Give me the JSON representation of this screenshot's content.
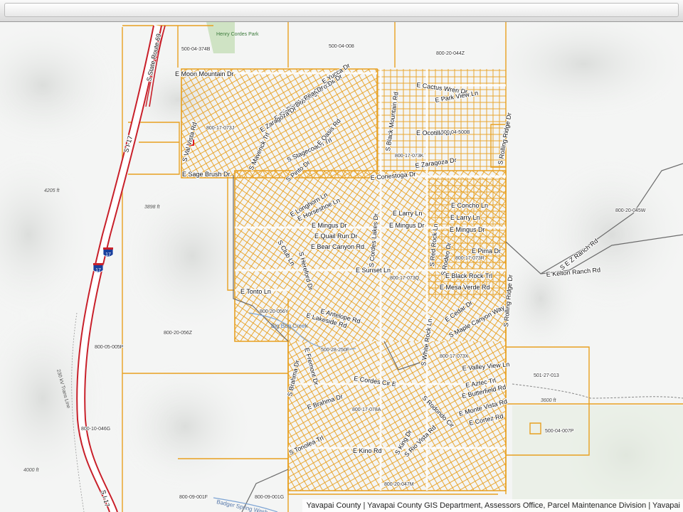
{
  "map": {
    "attribution": "Yavapai County | Yavapai County GIS Department, Assessors Office, Parcel Maintenance Division | Yavapai",
    "colors": {
      "parcel": "#e8a020",
      "road": "#6b6b6b",
      "highway": "#c8202a",
      "water": "#7da4d4",
      "park": "#cfe3c4",
      "terrain": "#f4f5f4"
    },
    "highway_shields": [
      "17",
      "17"
    ],
    "streets": [
      "E Moon Mountain Dr",
      "E Yucca Dr",
      "E Cholla Dr",
      "E Saguaro Dr",
      "E Ocotillo Dr",
      "E Prickly Pear Dr",
      "E Sierra Dr",
      "E Zaragoza Dr",
      "S Val Vista Rd",
      "S Maverick Trl",
      "S Stagecoach Trl",
      "E Oasis Rd",
      "S Pinto Dr",
      "E Sage Brush Dr",
      "E Conestoga Dr",
      "E Cactus Wren Dr",
      "E Park View Ln",
      "S Black Mountain Rd",
      "E Ocotillo Dr",
      "S Rolling Ridge Dr",
      "E Zaragoza Dr",
      "E Longhorn Ln",
      "E Horseshoe Ln",
      "E Concho Ln",
      "E Larry Ln",
      "E Larry Ln",
      "E Mingus Dr",
      "E Mingus Dr",
      "E Mingus Dr",
      "S Cordes Lakes Dr",
      "E Quail Run Dr",
      "S Club Ln",
      "S Hereford Dr",
      "E Bear Canyon Rd",
      "S Red Rock Ln",
      "S Rodeo Dr",
      "E Pima Dr",
      "E Sunset Ln",
      "E Black Rock Trl",
      "E Mesa Verde Rd",
      "E Tonto Ln",
      "E Antelope Rd",
      "E Lakeside Rd",
      "E Cedar Dr",
      "S Maple Canyon Way",
      "S Rolling Ridge Dr",
      "S Brahma Dr",
      "E Fremont Dr",
      "S White Rock Ln",
      "E Valley View Ln",
      "E Cordes Cir E",
      "E Aztec Trl",
      "E Butterfield Rd",
      "E Brahma Dr",
      "S Rodondo Cir",
      "E Monte Vista Rd",
      "E Cortez Rd",
      "S Tonolea Trl",
      "S King Dr",
      "S Rio Vista Rd",
      "E Kino Rd",
      "S E Z Ranch Rd",
      "E Kelton Ranch Rd",
      "S State Route 69",
      "S I-17",
      "S I-17"
    ],
    "parcels": [
      "500-04-374B",
      "500-04-008",
      "800-20-044Z",
      "500-04-500B",
      "800-17-073J",
      "800-17-073K",
      "800-17-073R",
      "800-17-073Q",
      "800-20-056Y",
      "800-20-056Z",
      "800-05-005P",
      "500-28-250F",
      "800-17-073X",
      "501-27-013",
      "800-17-078A",
      "800-20-045W",
      "800-10-046G",
      "500-04-007P",
      "800-20-047M",
      "800-09-001F",
      "800-09-001G"
    ],
    "places": [
      "Henry Cordes Park",
      "Big Bug Creek",
      "Badger Spring Wash",
      "230 kV Trans Line"
    ],
    "elevations": [
      "4205 ft",
      "3898 ft",
      "4000 ft",
      "3600 ft"
    ]
  }
}
